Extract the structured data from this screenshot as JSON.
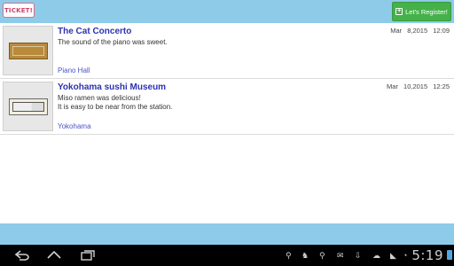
{
  "header": {
    "logo_text": "TICKET!",
    "register_label": "Let's Register!"
  },
  "items": [
    {
      "title": "The Cat Concerto",
      "date": "Mar 8,2015 12:09",
      "description": "The sound of the piano was sweet.",
      "place": "Piano Hall"
    },
    {
      "title": "Yokohama sushi Museum",
      "date": "Mar 10,2015 12:25",
      "description_line1": "Miso ramen was delicious!",
      "description_line2": "It is easy to be near from the station.",
      "place": "Yokohama"
    }
  ],
  "statusbar": {
    "time": "5:19"
  },
  "colors": {
    "bar": "#8ecbe8",
    "title": "#2a32b0",
    "register": "#45b14a"
  }
}
